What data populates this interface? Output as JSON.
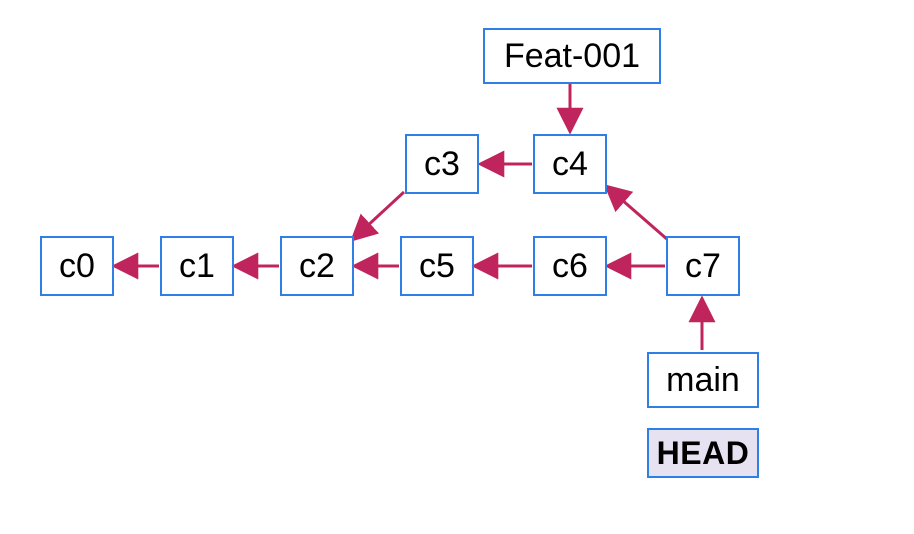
{
  "nodes": {
    "c0": "c0",
    "c1": "c1",
    "c2": "c2",
    "c3": "c3",
    "c4": "c4",
    "c5": "c5",
    "c6": "c6",
    "c7": "c7"
  },
  "labels": {
    "feat": "Feat-001",
    "main": "main",
    "head": "HEAD"
  },
  "chart_data": {
    "type": "graph",
    "title": "",
    "nodes": [
      {
        "id": "c0",
        "type": "commit"
      },
      {
        "id": "c1",
        "type": "commit"
      },
      {
        "id": "c2",
        "type": "commit"
      },
      {
        "id": "c3",
        "type": "commit"
      },
      {
        "id": "c4",
        "type": "commit"
      },
      {
        "id": "c5",
        "type": "commit"
      },
      {
        "id": "c6",
        "type": "commit"
      },
      {
        "id": "c7",
        "type": "commit"
      },
      {
        "id": "Feat-001",
        "type": "branch"
      },
      {
        "id": "main",
        "type": "branch"
      },
      {
        "id": "HEAD",
        "type": "head"
      }
    ],
    "edges": [
      {
        "from": "c1",
        "to": "c0",
        "kind": "parent"
      },
      {
        "from": "c2",
        "to": "c1",
        "kind": "parent"
      },
      {
        "from": "c3",
        "to": "c2",
        "kind": "parent"
      },
      {
        "from": "c4",
        "to": "c3",
        "kind": "parent"
      },
      {
        "from": "c5",
        "to": "c2",
        "kind": "parent"
      },
      {
        "from": "c6",
        "to": "c5",
        "kind": "parent"
      },
      {
        "from": "c7",
        "to": "c6",
        "kind": "parent"
      },
      {
        "from": "c7",
        "to": "c4",
        "kind": "parent"
      },
      {
        "from": "Feat-001",
        "to": "c4",
        "kind": "ref"
      },
      {
        "from": "main",
        "to": "c7",
        "kind": "ref"
      },
      {
        "from": "HEAD",
        "to": "main",
        "kind": "ref"
      }
    ]
  }
}
